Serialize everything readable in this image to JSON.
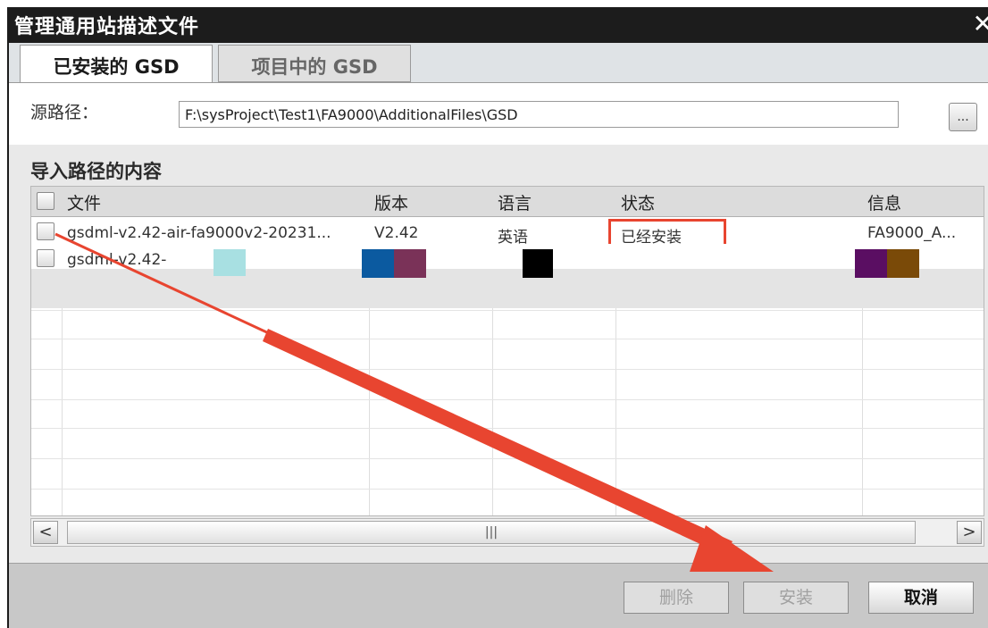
{
  "window": {
    "title": "管理通用站描述文件",
    "close_glyph": "✕"
  },
  "tabs": [
    {
      "label": "已安装的 GSD",
      "active": true
    },
    {
      "label": "项目中的 GSD",
      "active": false
    }
  ],
  "source": {
    "label": "源路径：",
    "path": "F:\\sysProject\\Test1\\FA9000\\AdditionalFiles\\GSD",
    "browse_label": "..."
  },
  "import_section": {
    "title": "导入路径的内容",
    "columns": [
      "文件",
      "版本",
      "语言",
      "状态",
      "信息"
    ],
    "rows": [
      {
        "file": "gsdml-v2.42-air-fa9000v2-20231...",
        "version": "V2.42",
        "language": "英语",
        "status": "已经安装",
        "info": "FA9000_A..."
      },
      {
        "file": "gsdml-v2.42-",
        "version": "",
        "language": "",
        "status": "",
        "info": ""
      }
    ]
  },
  "scrollbar": {
    "left_arrow": "<",
    "right_arrow": ">",
    "thumb_grip": "|||"
  },
  "buttons": {
    "delete": "删除",
    "install": "安装",
    "cancel": "取消"
  },
  "colors": {
    "annotation_red": "#e84530",
    "swatch_cyan": "#a8e0e2",
    "swatch_blue": "#0b5aa0",
    "swatch_wine": "#7a3258",
    "swatch_black": "#000000",
    "swatch_purple": "#5a0e62",
    "swatch_brown": "#7a4a08"
  }
}
